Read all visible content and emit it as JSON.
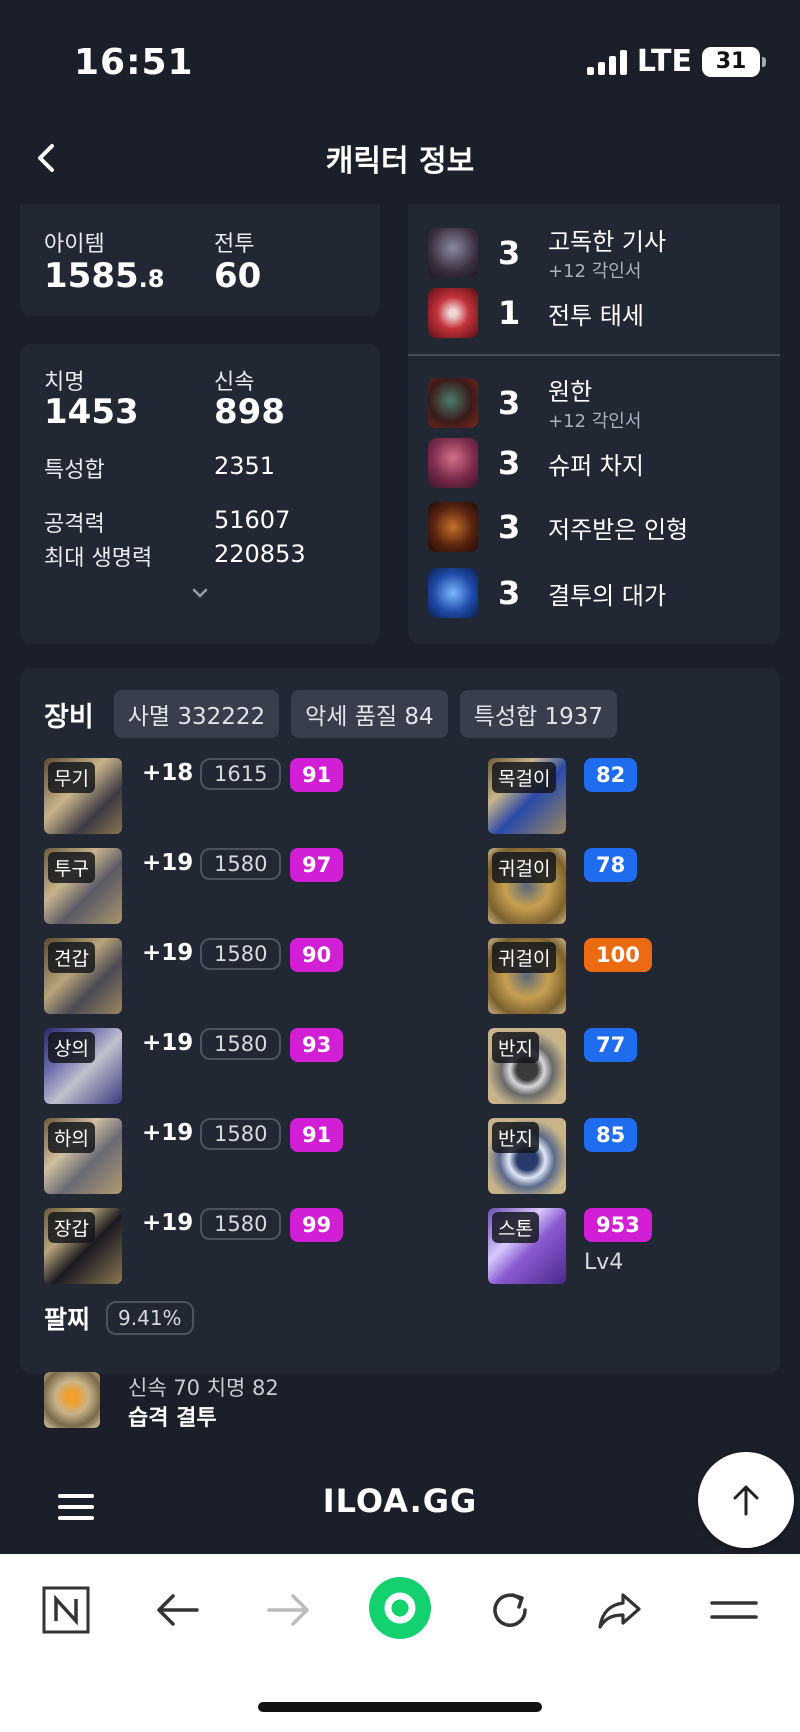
{
  "status": {
    "time": "16:51",
    "network": "LTE",
    "battery": "31"
  },
  "nav": {
    "title": "캐릭터 정보"
  },
  "stats": {
    "item_label": "아이템",
    "item_int": "1585",
    "item_dec": ".8",
    "combat_label": "전투",
    "combat_value": "60",
    "crit_label": "치명",
    "crit_value": "1453",
    "swift_label": "신속",
    "swift_value": "898",
    "sum_label": "특성합",
    "sum_value": "2351",
    "atk_label": "공격력",
    "atk_value": "51607",
    "hp_label": "최대 생명력",
    "hp_value": "220853"
  },
  "engravings": {
    "top": [
      {
        "level": "3",
        "name": "고독한 기사",
        "sub": "+12 각인서",
        "icon": "lone-knight-icon"
      },
      {
        "level": "1",
        "name": "전투 태세",
        "sub": "",
        "icon": "combat-stance-icon"
      }
    ],
    "bottom": [
      {
        "level": "3",
        "name": "원한",
        "sub": "+12 각인서",
        "icon": "grudge-icon"
      },
      {
        "level": "3",
        "name": "슈퍼 차지",
        "sub": "",
        "icon": "super-charge-icon"
      },
      {
        "level": "3",
        "name": "저주받은 인형",
        "sub": "",
        "icon": "cursed-doll-icon"
      },
      {
        "level": "3",
        "name": "결투의 대가",
        "sub": "",
        "icon": "master-brawler-icon"
      }
    ]
  },
  "equipment": {
    "title": "장비",
    "chips": [
      "사멸 332222",
      "악세 품질 84",
      "특성합 1937"
    ],
    "gear": [
      {
        "tag": "무기",
        "plus": "+18",
        "level": "1615",
        "quality": "91",
        "color": "pink"
      },
      {
        "tag": "투구",
        "plus": "+19",
        "level": "1580",
        "quality": "97",
        "color": "pink"
      },
      {
        "tag": "견갑",
        "plus": "+19",
        "level": "1580",
        "quality": "90",
        "color": "pink"
      },
      {
        "tag": "상의",
        "plus": "+19",
        "level": "1580",
        "quality": "93",
        "color": "pink"
      },
      {
        "tag": "하의",
        "plus": "+19",
        "level": "1580",
        "quality": "91",
        "color": "pink"
      },
      {
        "tag": "장갑",
        "plus": "+19",
        "level": "1580",
        "quality": "99",
        "color": "pink"
      }
    ],
    "accessories": [
      {
        "tag": "목걸이",
        "quality": "82",
        "color": "blue"
      },
      {
        "tag": "귀걸이",
        "quality": "78",
        "color": "blue"
      },
      {
        "tag": "귀걸이",
        "quality": "100",
        "color": "orange"
      },
      {
        "tag": "반지",
        "quality": "77",
        "color": "blue"
      },
      {
        "tag": "반지",
        "quality": "85",
        "color": "blue"
      },
      {
        "tag": "스톤",
        "quality": "953",
        "color": "pink",
        "sub": "Lv4"
      }
    ],
    "bracelet": {
      "title": "팔찌",
      "percent": "9.41%",
      "line1": "신속 70  치명 82",
      "line2": "습격  결투"
    }
  },
  "footer": {
    "brand": "ILOA.GG"
  },
  "colors": {
    "bg": "#1b1f2a",
    "card": "#222734",
    "pink": "#d21fd6",
    "blue": "#1f6dee",
    "orange": "#ec6b12"
  }
}
